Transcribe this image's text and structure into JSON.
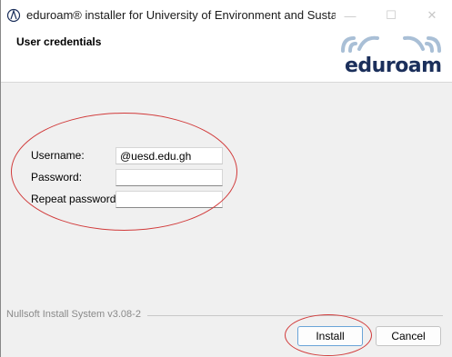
{
  "window": {
    "title": "eduroam® installer for University of Environment and Sustain...",
    "minimize_glyph": "—",
    "maximize_glyph": "☐",
    "close_glyph": "✕"
  },
  "header": {
    "title": "User credentials",
    "logo_text_edu": "edu",
    "logo_text_roam": "roam"
  },
  "form": {
    "username_label": "Username:",
    "username_value": "@uesd.edu.gh",
    "password_label": "Password:",
    "password_value": "",
    "repeat_password_label": "Repeat password:",
    "repeat_password_value": ""
  },
  "footer": {
    "branding": "Nullsoft Install System v3.08-2",
    "install_label": "Install",
    "cancel_label": "Cancel"
  },
  "colors": {
    "annotation": "#d13a3a",
    "logo_arcs": "#a9bfd6",
    "logo_text": "#1b2f5b",
    "primary_border": "#6aa4d8"
  }
}
